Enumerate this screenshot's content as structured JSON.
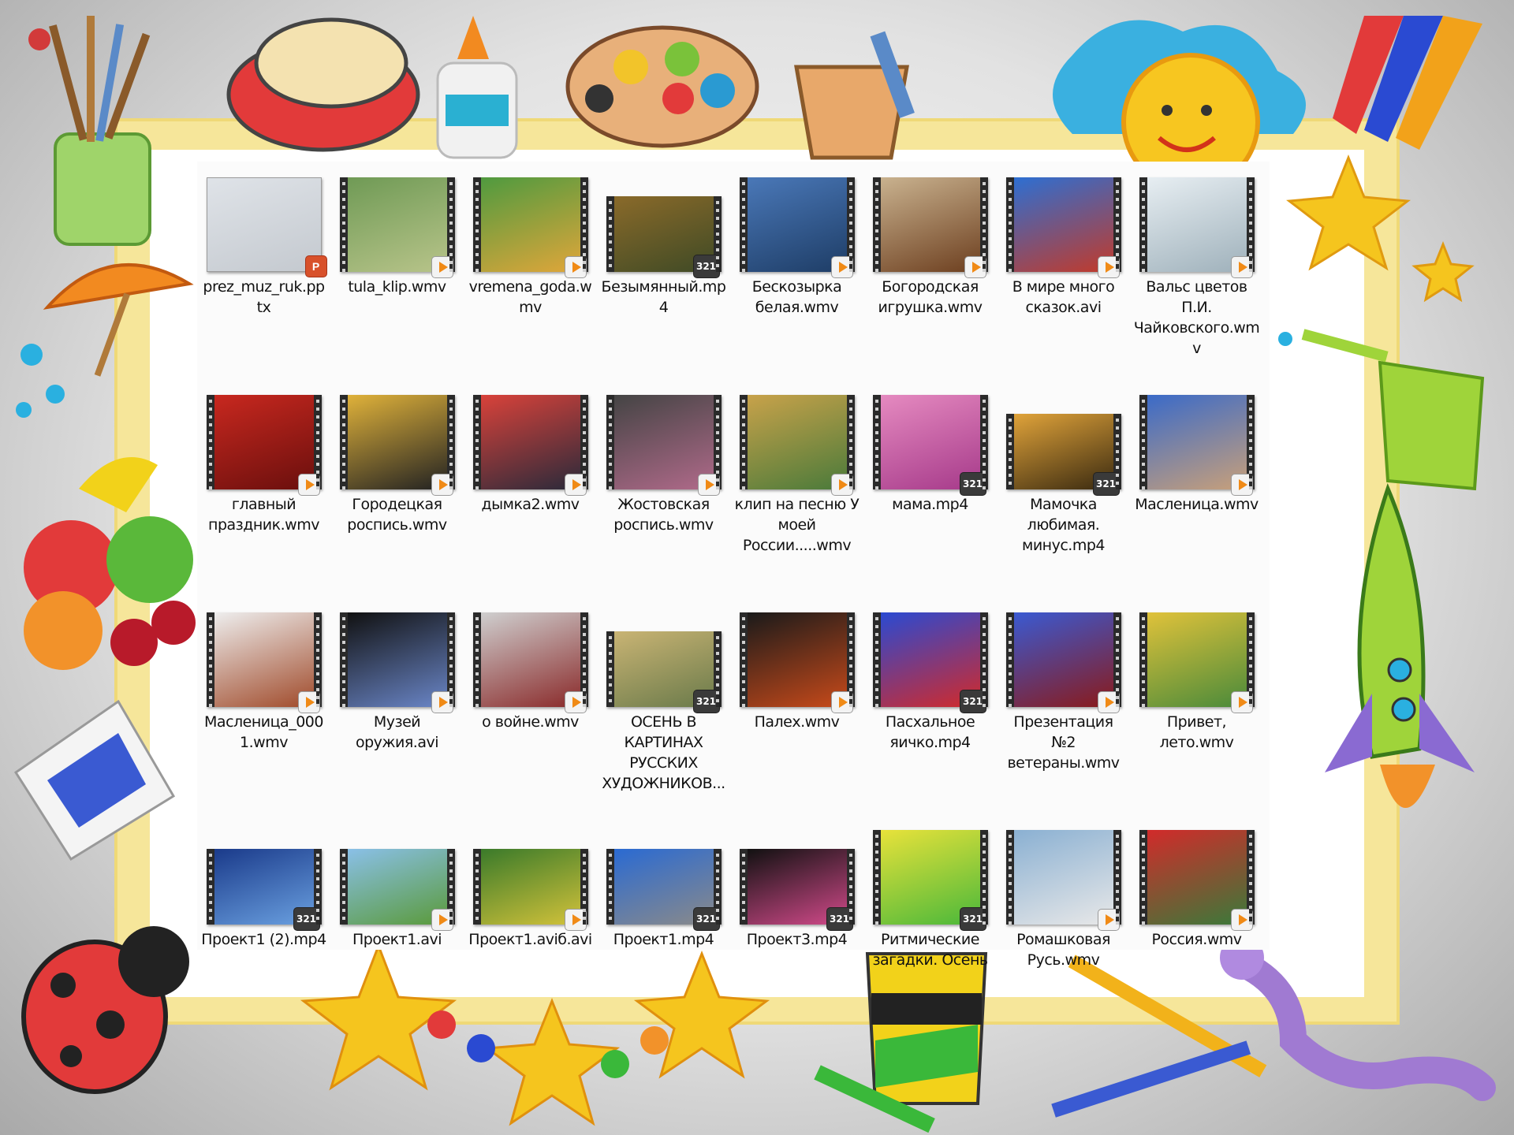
{
  "files": [
    {
      "name": "prez_muz_ruk.pptx",
      "kind": "ppt",
      "badge": "ppt-icon",
      "thumb": [
        "#dfe3e8",
        "#c4c9cf"
      ]
    },
    {
      "name": "tula_klip.wmv",
      "kind": "video",
      "badge": "play-icon",
      "thumb": [
        "#6f9a55",
        "#b8c48a"
      ]
    },
    {
      "name": "vremena_goda.wmv",
      "kind": "video",
      "badge": "play-icon",
      "thumb": [
        "#4f9a3f",
        "#e0a63a"
      ]
    },
    {
      "name": "Безымянный.mp4",
      "kind": "video",
      "badge": "mpc-icon",
      "thumb": [
        "#8a6a2a",
        "#3f4a25"
      ],
      "short": true
    },
    {
      "name": "Бескозырка белая.wmv",
      "kind": "video",
      "badge": "play-icon",
      "thumb": [
        "#4a78b8",
        "#1e3d66"
      ]
    },
    {
      "name": "Богородская игрушка.wmv",
      "kind": "video",
      "badge": "play-icon",
      "thumb": [
        "#c9b28f",
        "#6d3f1f"
      ]
    },
    {
      "name": "В мире много сказок.avi",
      "kind": "video",
      "badge": "play-icon",
      "thumb": [
        "#2d6fd2",
        "#c23a2a"
      ]
    },
    {
      "name": "Вальс цветов П.И. Чайковского.wmv",
      "kind": "video",
      "badge": "play-icon",
      "thumb": [
        "#e7eef2",
        "#9fb1bb"
      ]
    },
    {
      "name": "главный праздник.wmv",
      "kind": "video",
      "badge": "play-icon",
      "thumb": [
        "#c8281f",
        "#6a0f0d"
      ]
    },
    {
      "name": "Городецкая роспись.wmv",
      "kind": "video",
      "badge": "play-icon",
      "thumb": [
        "#e0b23a",
        "#222222"
      ]
    },
    {
      "name": "дымка2.wmv",
      "kind": "video",
      "badge": "play-icon",
      "thumb": [
        "#d9423a",
        "#2a2a3a"
      ]
    },
    {
      "name": "Жостовская роспись.wmv",
      "kind": "video",
      "badge": "play-icon",
      "thumb": [
        "#444444",
        "#b06a8a"
      ]
    },
    {
      "name": "клип на песню У моей России.....wmv",
      "kind": "video",
      "badge": "play-icon",
      "thumb": [
        "#c8a24a",
        "#4a7a3a"
      ]
    },
    {
      "name": "мама.mp4",
      "kind": "video",
      "badge": "mpc-icon",
      "thumb": [
        "#e58ac0",
        "#a63a8a"
      ]
    },
    {
      "name": "Мамочка любимая. минус.mp4",
      "kind": "video",
      "badge": "mpc-icon",
      "thumb": [
        "#e0a33a",
        "#3a2a10"
      ],
      "short": true
    },
    {
      "name": "Масленица.wmv",
      "kind": "video",
      "badge": "play-icon",
      "thumb": [
        "#3a6ac8",
        "#c8a07a"
      ]
    },
    {
      "name": "Масленица_0001.wmv",
      "kind": "video",
      "badge": "play-icon",
      "thumb": [
        "#eeeeee",
        "#a04a2a"
      ]
    },
    {
      "name": "Музей оружия.avi",
      "kind": "video",
      "badge": "play-icon",
      "thumb": [
        "#111111",
        "#6a86c8"
      ]
    },
    {
      "name": "о войне.wmv",
      "kind": "video",
      "badge": "play-icon",
      "thumb": [
        "#cfcfcf",
        "#8a2a2a"
      ]
    },
    {
      "name": "ОСЕНЬ В КАРТИНАХ РУССКИХ ХУДОЖНИКОВ...",
      "kind": "video",
      "badge": "mpc-icon",
      "thumb": [
        "#c9b474",
        "#6a7a4a"
      ],
      "short": true
    },
    {
      "name": "Палех.wmv",
      "kind": "video",
      "badge": "play-icon",
      "thumb": [
        "#1a1a1a",
        "#c84a1a"
      ]
    },
    {
      "name": "Пасхальное яичко.mp4",
      "kind": "video",
      "badge": "mpc-icon",
      "thumb": [
        "#2a4ad2",
        "#d22a2a"
      ]
    },
    {
      "name": "Презентация №2 ветераны.wmv",
      "kind": "video",
      "badge": "play-icon",
      "thumb": [
        "#3a5ad2",
        "#8a1a1a"
      ]
    },
    {
      "name": "Привет, лето.wmv",
      "kind": "video",
      "badge": "play-icon",
      "thumb": [
        "#e0c23a",
        "#4a8a3a"
      ]
    },
    {
      "name": "Проект1 (2).mp4",
      "kind": "video",
      "badge": "mpc-icon",
      "thumb": [
        "#1a3a8a",
        "#6aa0e0"
      ],
      "short": true
    },
    {
      "name": "Проект1.avi",
      "kind": "video",
      "badge": "play-icon",
      "thumb": [
        "#8ac0e8",
        "#5a9a3a"
      ],
      "short": true
    },
    {
      "name": "Проект1.aviб.avi",
      "kind": "video",
      "badge": "play-icon",
      "thumb": [
        "#3a7a2a",
        "#d2c23a"
      ],
      "short": true
    },
    {
      "name": "Проект1.mp4",
      "kind": "video",
      "badge": "mpc-icon",
      "thumb": [
        "#2a6ad2",
        "#8a8a8a"
      ],
      "short": true
    },
    {
      "name": "Проект3.mp4",
      "kind": "video",
      "badge": "mpc-icon",
      "thumb": [
        "#111111",
        "#d24a8a"
      ],
      "short": true
    },
    {
      "name": "Ритмические загадки. Осень",
      "kind": "video",
      "badge": "mpc-icon",
      "thumb": [
        "#e8e23a",
        "#4ab83a"
      ]
    },
    {
      "name": "Ромашковая Русь.wmv",
      "kind": "video",
      "badge": "play-icon",
      "thumb": [
        "#8ab0d2",
        "#e8e8e8"
      ]
    },
    {
      "name": "Россия.wmv",
      "kind": "video",
      "badge": "play-icon",
      "thumb": [
        "#d22a2a",
        "#3a7a3a"
      ]
    }
  ],
  "colors": {
    "frame": "#f6e69a",
    "badge_play": "#f08a16",
    "badge_ppt": "#d8512b",
    "film_edge": "#2a2a2a"
  },
  "mpc_label": "321",
  "ppt_label": "P"
}
